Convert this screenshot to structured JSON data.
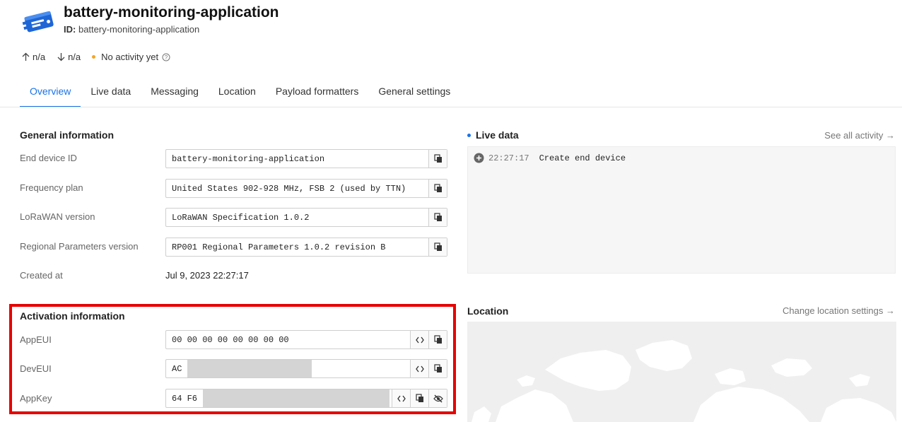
{
  "header": {
    "title": "battery-monitoring-application",
    "id_label": "ID:",
    "id_value": "battery-monitoring-application"
  },
  "stats": {
    "uplink": "n/a",
    "downlink": "n/a",
    "activity": "No activity yet"
  },
  "tabs": [
    {
      "label": "Overview",
      "active": true
    },
    {
      "label": "Live data"
    },
    {
      "label": "Messaging"
    },
    {
      "label": "Location"
    },
    {
      "label": "Payload formatters"
    },
    {
      "label": "General settings"
    }
  ],
  "general": {
    "title": "General information",
    "rows": [
      {
        "label": "End device ID",
        "value": "battery-monitoring-application"
      },
      {
        "label": "Frequency plan",
        "value": "United States 902-928 MHz, FSB 2 (used by TTN)"
      },
      {
        "label": "LoRaWAN version",
        "value": "LoRaWAN Specification 1.0.2"
      },
      {
        "label": "Regional Parameters version",
        "value": "RP001 Regional Parameters 1.0.2 revision B"
      }
    ],
    "created_label": "Created at",
    "created_value": "Jul 9, 2023 22:27:17"
  },
  "activation": {
    "title": "Activation information",
    "appeui_label": "AppEUI",
    "appeui_value": "00 00 00 00 00 00 00 00",
    "deveui_label": "DevEUI",
    "deveui_value": "AC",
    "appkey_label": "AppKey",
    "appkey_value": "64 F6"
  },
  "live": {
    "title": "Live data",
    "link": "See all activity →",
    "events": [
      {
        "time": "22:27:17",
        "message": "Create end device"
      }
    ]
  },
  "location": {
    "title": "Location",
    "link": "Change location settings →"
  },
  "colors": {
    "accent": "#1a73e8",
    "highlight": "#e60000",
    "activity_dot": "#f5a623"
  }
}
